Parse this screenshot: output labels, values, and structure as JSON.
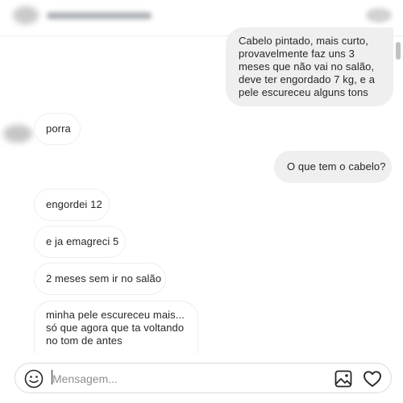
{
  "composer": {
    "placeholder": "Mensagem..."
  },
  "messages": [
    {
      "direction": "outgoing",
      "text": "Cabelo pintado, mais curto,\nprovavelmente faz uns 3\nmeses que não vai no salão,\ndeve ter engordado 7 kg, e a\npele escureceu alguns tons"
    },
    {
      "direction": "incoming",
      "text": "porra"
    },
    {
      "direction": "outgoing",
      "text": "O que tem o cabelo?"
    },
    {
      "direction": "incoming",
      "text": "engordei 12"
    },
    {
      "direction": "incoming",
      "text": "e ja emagreci 5"
    },
    {
      "direction": "incoming",
      "text": "2 meses sem ir no salão"
    },
    {
      "direction": "incoming",
      "text": "minha pele escureceu mais...\nsó que agora que ta voltando\nno tom de antes"
    }
  ],
  "icons": {
    "emoji": "smiley-icon",
    "image": "image-icon",
    "heart": "heart-icon",
    "info": "info-icon"
  },
  "colors": {
    "outgoing_bubble": "#efefef",
    "incoming_border": "#efefef",
    "divider": "#ececec",
    "text": "#262626",
    "placeholder": "#8e8e8e"
  }
}
